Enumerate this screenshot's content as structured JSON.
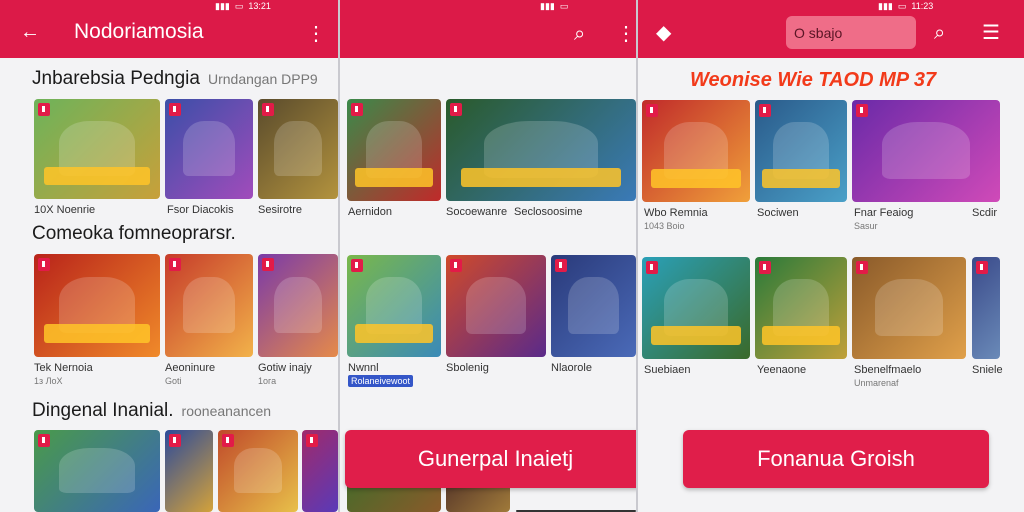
{
  "colors": {
    "appbar": "#dc1a48",
    "button": "#e01e4a",
    "panel": "#f3f3f5"
  },
  "left": {
    "status_time": "13:21",
    "title": "Nodoriamosia",
    "sections": [
      {
        "title": "Jnbarebsia Pedngia",
        "subtitle": "Urndangan DPP9"
      },
      {
        "title": "Comeoka fomneoprarsr.",
        "subtitle": ""
      },
      {
        "title": "Dingenal Inanial.",
        "subtitle": "rooneanancen"
      }
    ],
    "row1_captions": [
      "10Х Noenrie",
      "Fsor Diacokis",
      "Sesirotre"
    ],
    "row2_captions": [
      "Tek Nernoia",
      "Aeoninure",
      "Gotiw inajy"
    ],
    "row2_sub": [
      "1з ЛоX",
      "Goti",
      "1oга"
    ]
  },
  "middle": {
    "row1_captions": [
      "Aernidon",
      "Socoewanre",
      "Seclosoosime"
    ],
    "row2_captions": [
      "Nwnnl",
      "Sbolenig",
      "Nlaorole"
    ],
    "row2_tag": "Rolaneivewoot",
    "button_label": "Gunerpal Inaietj"
  },
  "right": {
    "status_time": "11:23",
    "search_text": "O sbajo",
    "promo": "Weonise Wie TAOD MP 37",
    "row1_captions": [
      "Wbo Remnia",
      "Sociwen",
      "Fnar Feaiog",
      "Scdir"
    ],
    "row1_sub": [
      "1043 Boio",
      "",
      "Sasur",
      ""
    ],
    "row2_captions": [
      "Suebiaen",
      "Yeenaone",
      "Sbenelfmaelo",
      "Sniele"
    ],
    "row2_sub": [
      "",
      "",
      "Unmarenaf",
      ""
    ],
    "button_label": "Fonanua Groish"
  },
  "icons": [
    "back-arrow-icon",
    "more-vert-icon",
    "search-icon",
    "heart-icon",
    "menu-icon",
    "app-badge-icon"
  ]
}
